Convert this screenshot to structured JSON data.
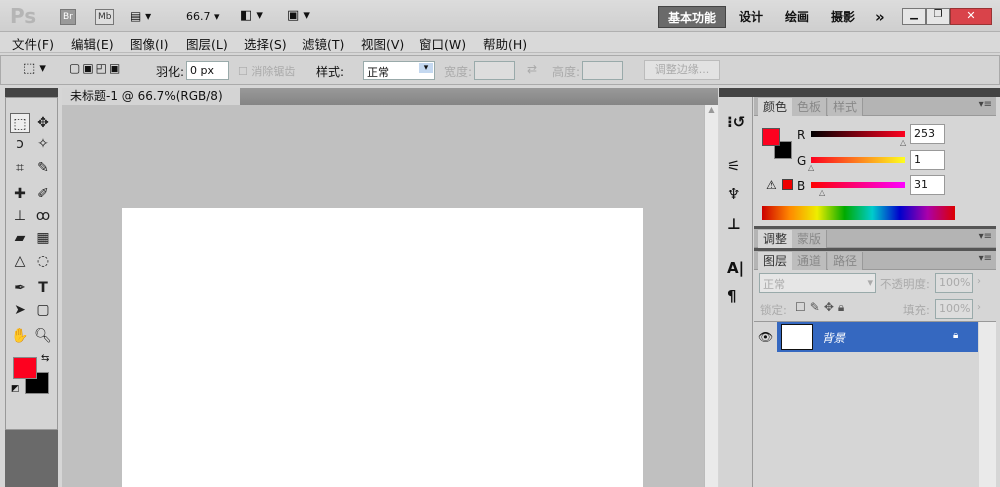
{
  "app": {
    "logo": "Ps",
    "bridge": "Br",
    "minibridge": "Mb",
    "zoom": "66.7"
  },
  "workspaces": [
    {
      "label": "基本功能",
      "active": true
    },
    {
      "label": "设计"
    },
    {
      "label": "绘画"
    },
    {
      "label": "摄影"
    },
    {
      "label": "»"
    }
  ],
  "menu": [
    "文件(F)",
    "编辑(E)",
    "图像(I)",
    "图层(L)",
    "选择(S)",
    "滤镜(T)",
    "视图(V)",
    "窗口(W)",
    "帮助(H)"
  ],
  "options": {
    "feather_label": "羽化:",
    "feather_value": "0 px",
    "antialias_label": "消除锯齿",
    "style_label": "样式:",
    "style_value": "正常",
    "width_label": "宽度:",
    "height_label": "高度:",
    "refine_label": "调整边缘..."
  },
  "document": {
    "tab_title": "未标题-1 @ 66.7%(RGB/8)"
  },
  "color_panel": {
    "tabs": [
      "颜色",
      "色板",
      "样式"
    ],
    "r_label": "R",
    "g_label": "G",
    "b_label": "B",
    "r": "253",
    "g": "1",
    "b": "31",
    "foreground": "#fd011f",
    "background": "#000000"
  },
  "adjust_panel": {
    "tabs": [
      "调整",
      "蒙版"
    ]
  },
  "layers_panel": {
    "tabs": [
      "图层",
      "通道",
      "路径"
    ],
    "blend_mode": "正常",
    "opacity_label": "不透明度:",
    "opacity": "100%",
    "lock_label": "锁定:",
    "fill_label": "填充:",
    "fill": "100%",
    "layers": [
      {
        "name": "背景",
        "selected": true
      }
    ]
  },
  "colors": {
    "selection": "#3568c0",
    "close": "#d9434a"
  }
}
